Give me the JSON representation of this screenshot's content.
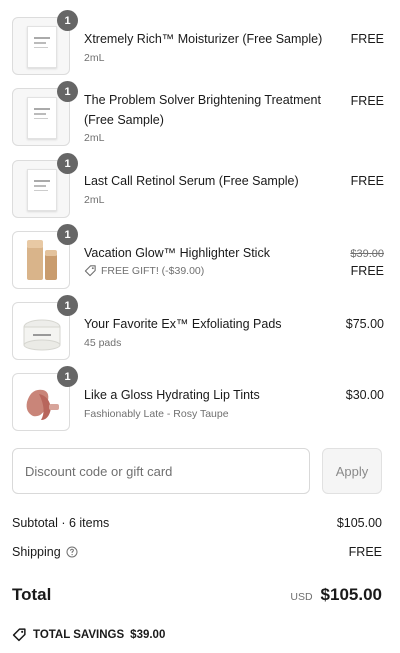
{
  "items": [
    {
      "qty": "1",
      "name": "Xtremely Rich™ Moisturizer (Free Sample)",
      "variant": "2mL",
      "price": "FREE",
      "image_icon": "sample-sachet-icon"
    },
    {
      "qty": "1",
      "name": "The Problem Solver Brightening Treatment (Free Sample)",
      "variant": "2mL",
      "price": "FREE",
      "image_icon": "sample-sachet-icon"
    },
    {
      "qty": "1",
      "name": "Last Call Retinol Serum (Free Sample)",
      "variant": "2mL",
      "price": "FREE",
      "image_icon": "sample-sachet-icon"
    },
    {
      "qty": "1",
      "name": "Vacation Glow™ Highlighter Stick",
      "gift_label": "FREE GIFT! (-$39.00)",
      "original_price": "$39.00",
      "price": "FREE",
      "image_icon": "highlighter-stick-icon"
    },
    {
      "qty": "1",
      "name": "Your Favorite Ex™ Exfoliating Pads",
      "variant": "45 pads",
      "price": "$75.00",
      "image_icon": "pad-jar-icon"
    },
    {
      "qty": "1",
      "name": "Like a Gloss Hydrating Lip Tints",
      "variant": "Fashionably Late - Rosy Taupe",
      "price": "$30.00",
      "image_icon": "lip-tint-icon"
    }
  ],
  "discount": {
    "placeholder": "Discount code or gift card",
    "apply_label": "Apply"
  },
  "summary": {
    "subtotal_label": "Subtotal · 6 items",
    "subtotal_value": "$105.00",
    "shipping_label": "Shipping",
    "shipping_value": "FREE",
    "total_label": "Total",
    "currency": "USD",
    "total_value": "$105.00",
    "savings_label": "TOTAL SAVINGS",
    "savings_value": "$39.00"
  },
  "colors": {
    "badge": "#666666",
    "muted_text": "#707070",
    "border": "#d9d9d9"
  }
}
